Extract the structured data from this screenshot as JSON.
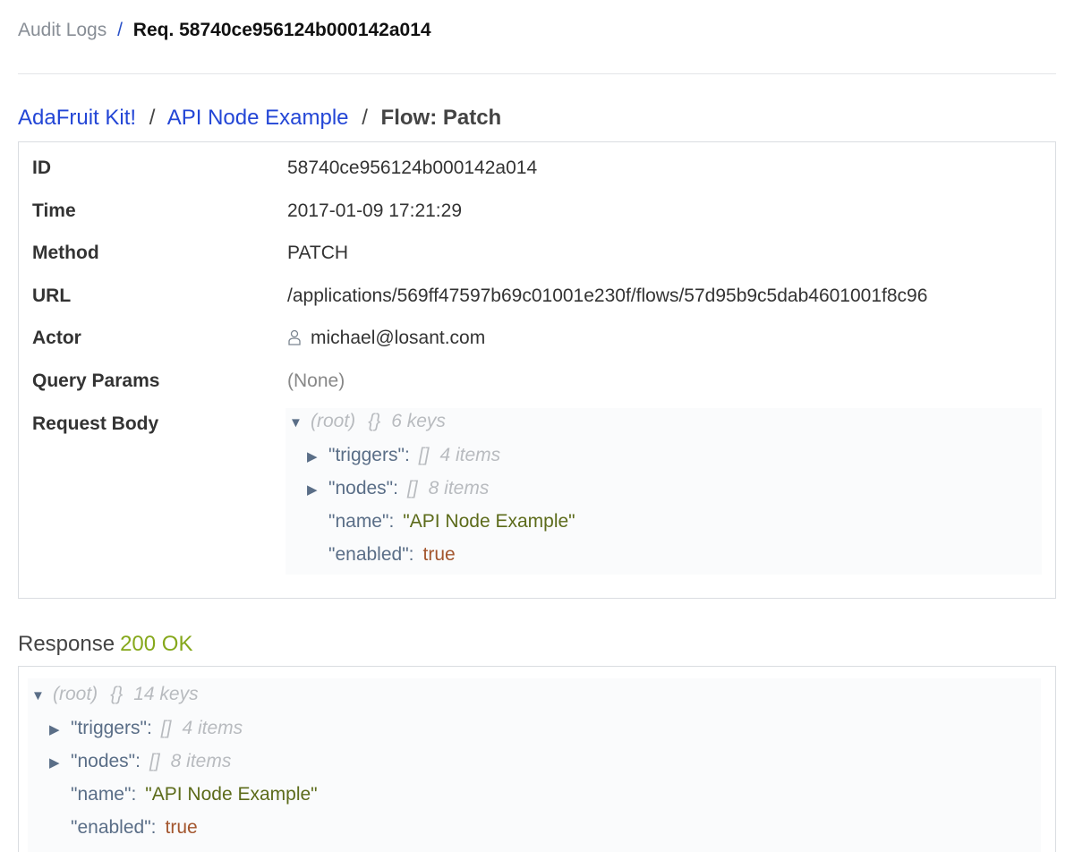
{
  "breadcrumb": {
    "parent": "Audit Logs",
    "separator": "/",
    "current": "Req. 58740ce956124b000142a014"
  },
  "section": {
    "application": "AdaFruit Kit!",
    "flow": "API Node Example",
    "separator": "/",
    "current": "Flow: Patch"
  },
  "details": {
    "id_label": "ID",
    "id_value": "58740ce956124b000142a014",
    "time_label": "Time",
    "time_value": "2017-01-09 17:21:29",
    "method_label": "Method",
    "method_value": "PATCH",
    "url_label": "URL",
    "url_value": "/applications/569ff47597b69c01001e230f/flows/57d95b9c5dab4601001f8c96",
    "actor_label": "Actor",
    "actor_value": "michael@losant.com",
    "actor_icon": "user-icon",
    "query_label": "Query Params",
    "query_value": "(None)",
    "body_label": "Request Body"
  },
  "request_body": {
    "root_label": "(root)",
    "root_type": "{}",
    "root_count": "6 keys",
    "triggers_key": "\"triggers\"",
    "triggers_type": "[]",
    "triggers_count": "4 items",
    "nodes_key": "\"nodes\"",
    "nodes_type": "[]",
    "nodes_count": "8 items",
    "name_key": "\"name\"",
    "name_value": "\"API Node Example\"",
    "enabled_key": "\"enabled\"",
    "enabled_value": "true"
  },
  "response": {
    "label": "Response",
    "status": "200 OK",
    "status_color": "#86a81c",
    "root_label": "(root)",
    "root_type": "{}",
    "root_count": "14 keys",
    "triggers_key": "\"triggers\"",
    "triggers_type": "[]",
    "triggers_count": "4 items",
    "nodes_key": "\"nodes\"",
    "nodes_type": "[]",
    "nodes_count": "8 items",
    "name_key": "\"name\"",
    "name_value": "\"API Node Example\"",
    "enabled_key": "\"enabled\"",
    "enabled_value": "true"
  },
  "tree_glyphs": {
    "expanded": "▼",
    "collapsed": "▶",
    "colon": ":"
  }
}
